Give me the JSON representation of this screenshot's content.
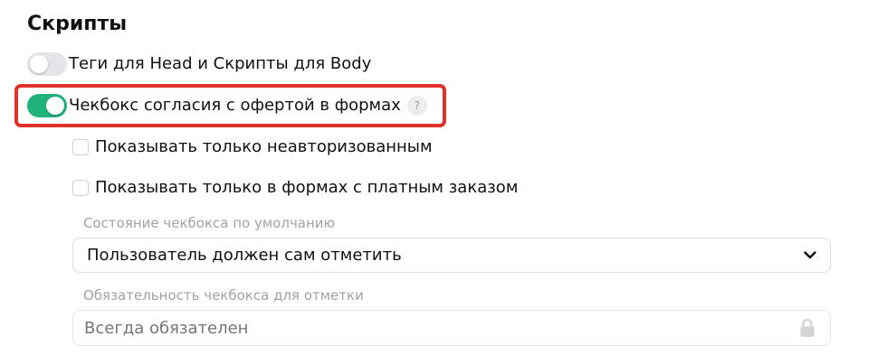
{
  "section": {
    "title": "Скрипты"
  },
  "toggles": [
    {
      "label": "Теги для Head и Скрипты для Body",
      "state": "off"
    },
    {
      "label": "Чекбокс согласия с офертой в формах",
      "state": "on",
      "help_glyph": "?"
    }
  ],
  "checkboxes": [
    {
      "label": "Показывать только неавторизованным",
      "checked": false
    },
    {
      "label": "Показывать только в формах с платным заказом",
      "checked": false
    }
  ],
  "default_state": {
    "label": "Состояние чекбокса по умолчанию",
    "selected": "Пользователь должен сам отметить"
  },
  "required": {
    "label": "Обязательность чекбокса для отметки",
    "placeholder": "Всегда обязателен",
    "disabled": true
  },
  "icons": {
    "select": "chevron-down-icon",
    "required_field": "lock-icon",
    "help": "question-icon"
  },
  "colors": {
    "toggle_on": "#1fb37b",
    "toggle_off": "#e4e5e8",
    "highlight": "#e0312b",
    "muted_text": "#a1a2a6"
  }
}
